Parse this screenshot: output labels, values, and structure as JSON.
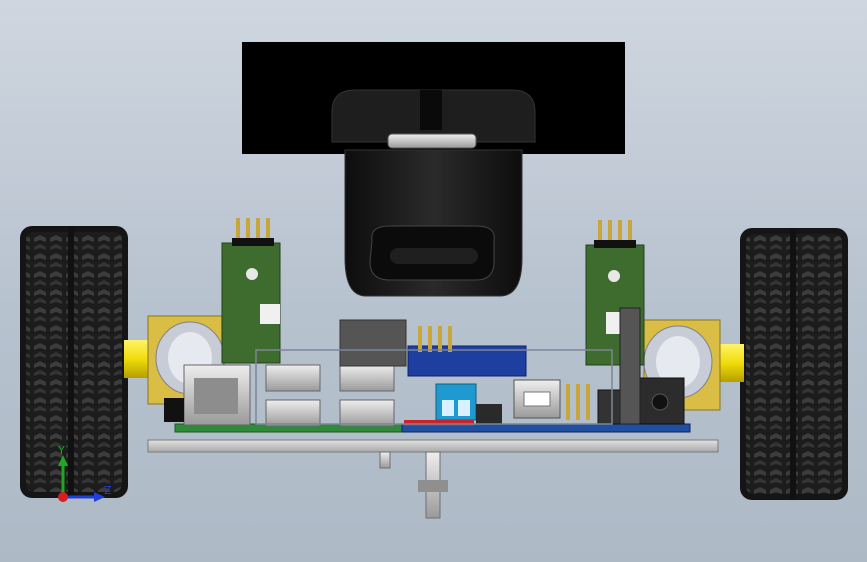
{
  "viewport": {
    "background_top": "#cfd6df",
    "background_bottom": "#aeb9c6"
  },
  "triad": {
    "y_label": "Y",
    "z_label": "Z",
    "y_color": "#1fa81f",
    "z_color": "#1f3fd8",
    "origin_color": "#d81f1f"
  },
  "colors": {
    "tire": "#1a1a1a",
    "tire_tread": "#3a3a3a",
    "motor_yellow": "#f0dc0a",
    "motor_gold": "#d8b63c",
    "pcb_green": "#2f7a2f",
    "sensor_board": "#3e6b2e",
    "pcb_blue": "#1e4fa0",
    "chassis": "#c9c9c9",
    "camera": "#151515",
    "display": "#000000"
  }
}
